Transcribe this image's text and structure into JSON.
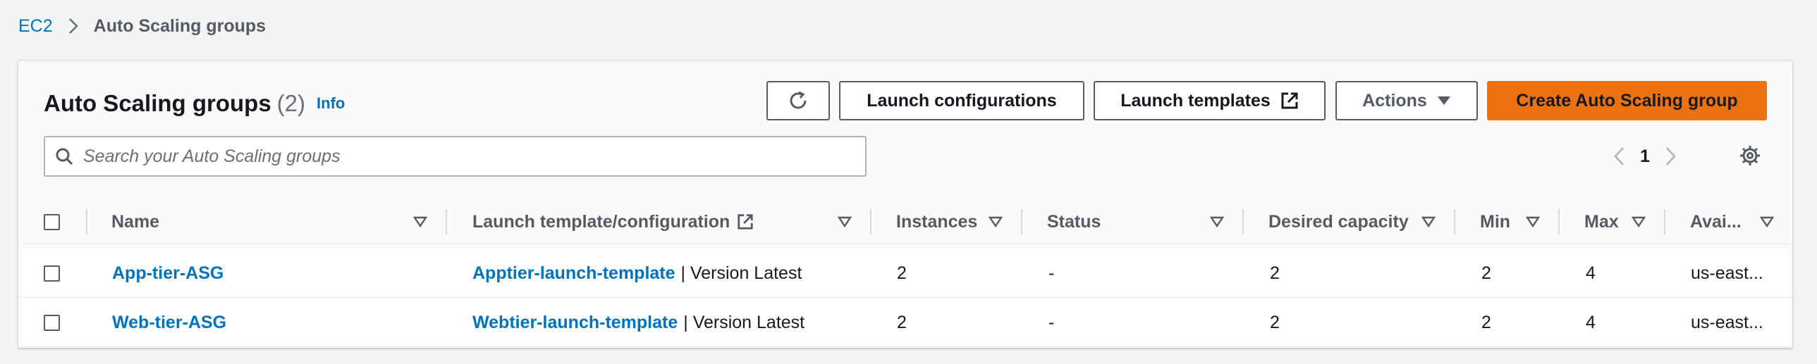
{
  "breadcrumb": {
    "root": "EC2",
    "current": "Auto Scaling groups"
  },
  "header": {
    "title": "Auto Scaling groups",
    "count": "(2)",
    "info": "Info",
    "buttons": {
      "launch_configurations": "Launch configurations",
      "launch_templates": "Launch templates",
      "actions": "Actions",
      "create": "Create Auto Scaling group"
    }
  },
  "search": {
    "placeholder": "Search your Auto Scaling groups",
    "value": ""
  },
  "pagination": {
    "page": "1"
  },
  "table": {
    "columns": {
      "name": "Name",
      "launch": "Launch template/configuration",
      "instances": "Instances",
      "status": "Status",
      "desired": "Desired capacity",
      "min": "Min",
      "max": "Max",
      "az": "Avai..."
    },
    "rows": [
      {
        "name": "App-tier-ASG",
        "template": "Apptier-launch-template",
        "version": "| Version Latest",
        "instances": "2",
        "status": "-",
        "desired": "2",
        "min": "2",
        "max": "4",
        "az": "us-east..."
      },
      {
        "name": "Web-tier-ASG",
        "template": "Webtier-launch-template",
        "version": "| Version Latest",
        "instances": "2",
        "status": "-",
        "desired": "2",
        "min": "2",
        "max": "4",
        "az": "us-east..."
      }
    ]
  },
  "colors": {
    "link": "#0073bb",
    "primary": "#ec7211",
    "text": "#16191f",
    "muted": "#545b64"
  }
}
